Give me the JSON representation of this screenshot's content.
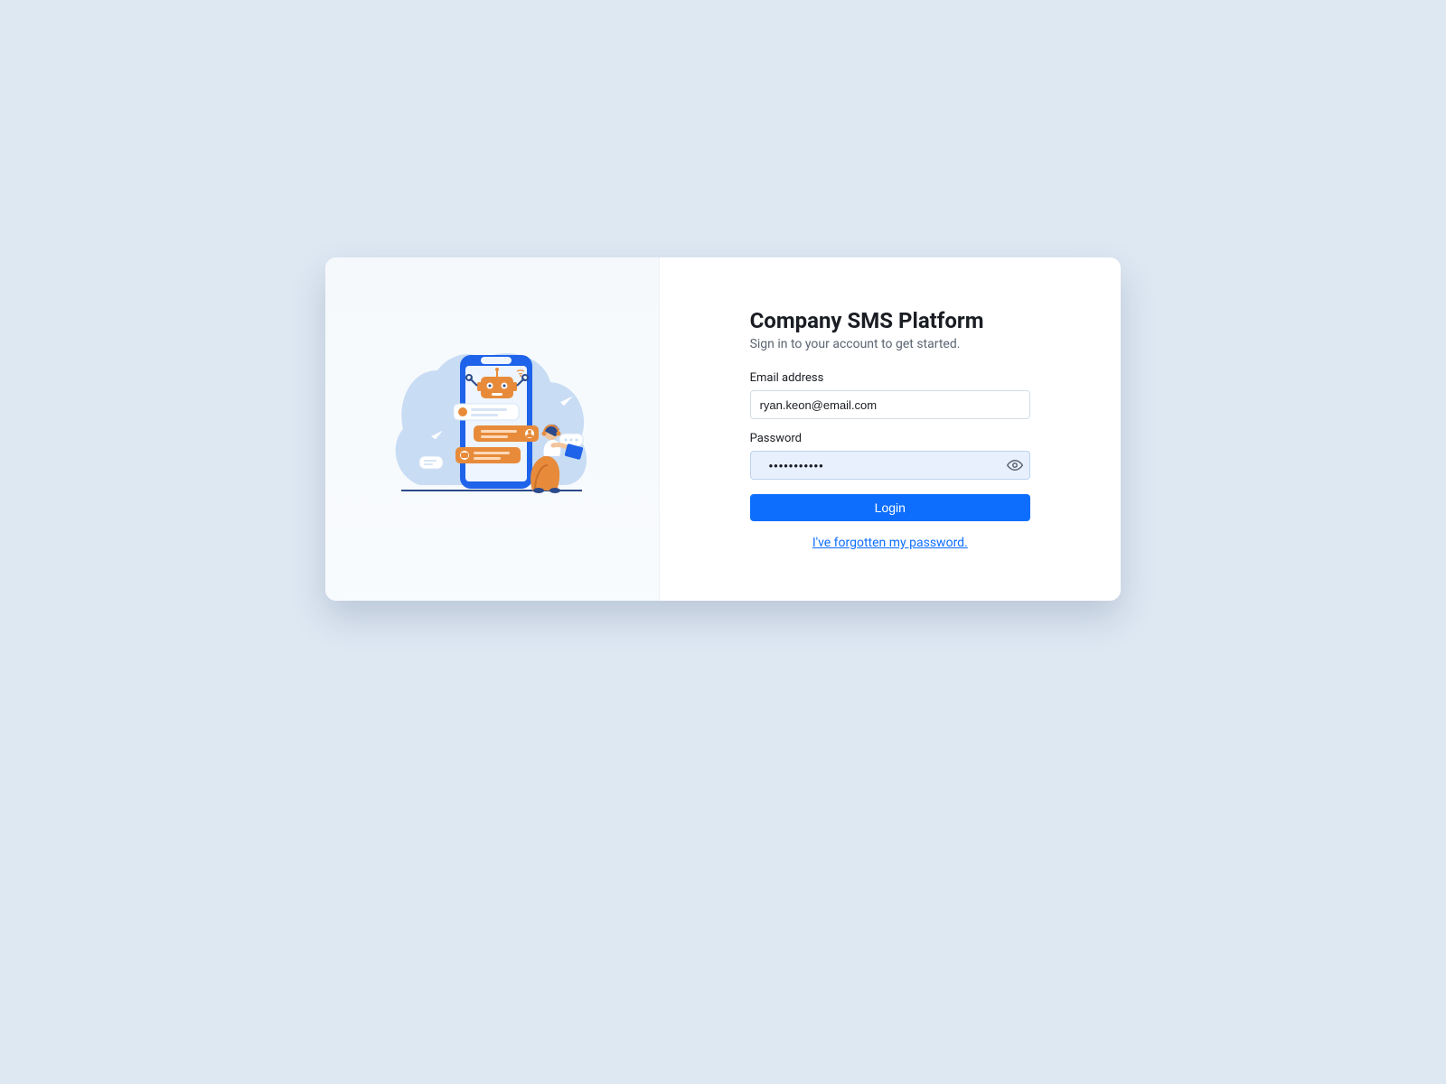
{
  "title": "Company SMS Platform",
  "subtitle": "Sign in to your account to get started.",
  "email": {
    "label": "Email address",
    "value": "ryan.keon@email.com"
  },
  "password": {
    "label": "Password",
    "value": "•••••••••••"
  },
  "login_label": "Login",
  "forgot_label": "I've forgotten my password."
}
